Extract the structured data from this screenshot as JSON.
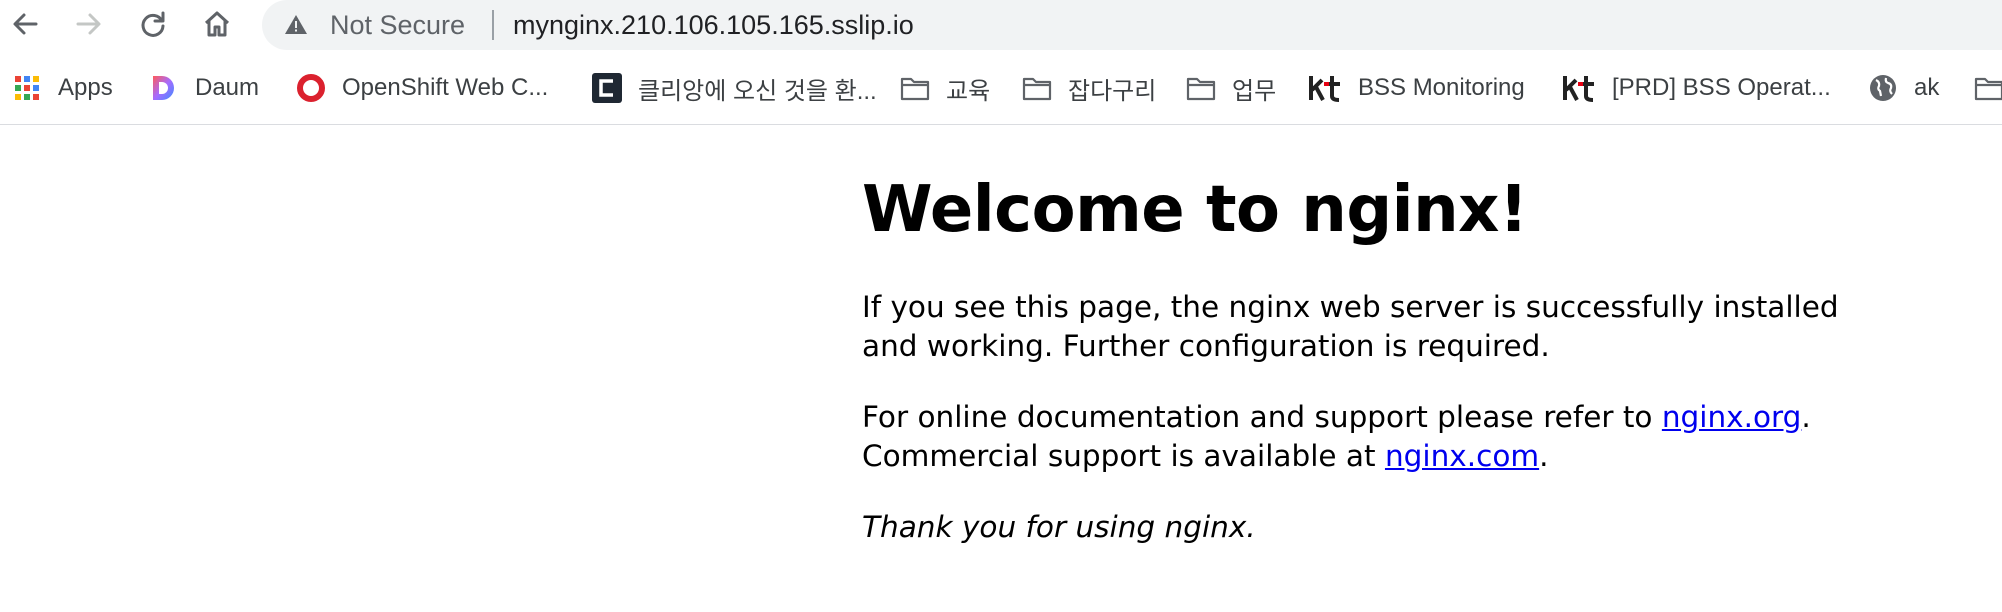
{
  "browser": {
    "security_label": "Not Secure",
    "url": "mynginx.210.106.105.165.sslip.io",
    "icons": {
      "back": "arrow-left-icon",
      "forward": "arrow-right-icon",
      "reload": "reload-icon",
      "home": "home-icon",
      "warning": "warning-triangle-icon"
    },
    "colors": {
      "toolbar_text": "#5f6368",
      "omnibox_bg": "#f1f3f4"
    }
  },
  "bookmarks": [
    {
      "label": "Apps",
      "icon": "apps-grid-icon"
    },
    {
      "label": "Daum",
      "icon": "daum-logo-icon"
    },
    {
      "label": "OpenShift Web C...",
      "icon": "openshift-logo-icon"
    },
    {
      "label": "클리앙에 오신 것을 환...",
      "icon": "clien-logo-icon"
    },
    {
      "label": "교육",
      "icon": "folder-icon"
    },
    {
      "label": "잡다구리",
      "icon": "folder-icon"
    },
    {
      "label": "업무",
      "icon": "folder-icon"
    },
    {
      "label": "BSS Monitoring",
      "icon": "kt-logo-icon"
    },
    {
      "label": "[PRD] BSS Operat...",
      "icon": "kt-logo-icon"
    },
    {
      "label": "ak",
      "icon": "globe-icon"
    },
    {
      "label": "",
      "icon": "folder-icon"
    }
  ],
  "page": {
    "heading": "Welcome to nginx!",
    "para1": "If you see this page, the nginx web server is successfully installed and working. Further configuration is required.",
    "para2_prefix": "For online documentation and support please refer to ",
    "link_org": "nginx.org",
    "para2_middle": ".",
    "para2_line2_prefix": "Commercial support is available at ",
    "link_com": "nginx.com",
    "para2_suffix": ".",
    "para3": "Thank you for using nginx.",
    "colors": {
      "link": "#0000ee"
    }
  }
}
